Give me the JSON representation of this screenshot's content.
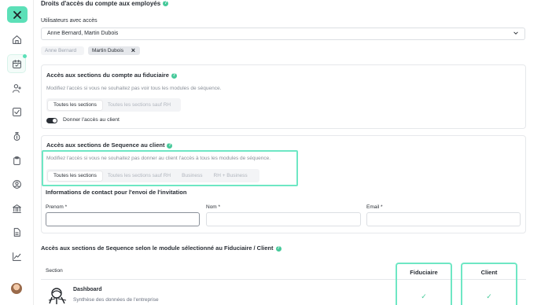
{
  "sidebar": {
    "logo_icon": "sequence-logo-icon",
    "items": [
      {
        "name": "home-icon"
      },
      {
        "name": "calendar-icon",
        "active": true
      },
      {
        "name": "users-icon"
      },
      {
        "name": "checklist-icon"
      },
      {
        "name": "money-bag-icon"
      },
      {
        "name": "clipboard-icon"
      },
      {
        "name": "user-circle-icon"
      },
      {
        "name": "bank-icon"
      },
      {
        "name": "document-icon"
      },
      {
        "name": "chart-line-icon"
      }
    ],
    "accent_color": "#5ce0b8"
  },
  "page": {
    "title": "Droits d'accès du compte aux employés"
  },
  "users": {
    "label": "Utilisateurs avec accès",
    "selected_value": "Anne Bernard, Martin Dubois",
    "chips": [
      {
        "label": "Anne Bernard",
        "state": "disabled"
      },
      {
        "label": "Martin Dubois",
        "state": "selected",
        "remove": "×"
      }
    ]
  },
  "fiduciaire_card": {
    "title": "Accès aux sections du compte au fiduciaire",
    "subtitle": "Modifiez l'accès si vous ne souhaitez pas voir tous les modules de séquence.",
    "options": [
      "Toutes les sections",
      "Toutes les sections sauf RH"
    ],
    "selected_option": "Toutes les sections",
    "toggle_label": "Donner l'accès au client",
    "toggle_on": true
  },
  "client_card": {
    "title": "Accès aux sections de Sequence au client",
    "subtitle": "Modifiez l'accès si vous ne souhaitez pas donner au client l'accès à tous les modules de séquence.",
    "options": [
      "Toutes les sections",
      "Toutes les sections sauf RH",
      "Business",
      "RH + Business"
    ],
    "selected_option": "Toutes les sections",
    "contact_title": "Informations de contact pour l'envoi de l'invitation",
    "fields": {
      "prenom_label": "Prenom *",
      "nom_label": "Nom *",
      "email_label": "Email *",
      "prenom_value": "",
      "nom_value": "",
      "email_value": ""
    }
  },
  "modules": {
    "title": "Accès aux sections de Sequence selon le module sélectionné au Fiduciaire / Client",
    "col_section": "Section",
    "col_fiduciaire": "Fiduciaire",
    "col_client": "Client",
    "rows": [
      {
        "title": "Dashboard",
        "subtitle": "Synthèse des données de l'entreprise",
        "fiduciaire": "✓",
        "client": "✓"
      }
    ]
  },
  "colors": {
    "highlight": "#6ee7c4",
    "check": "#46c99a"
  }
}
